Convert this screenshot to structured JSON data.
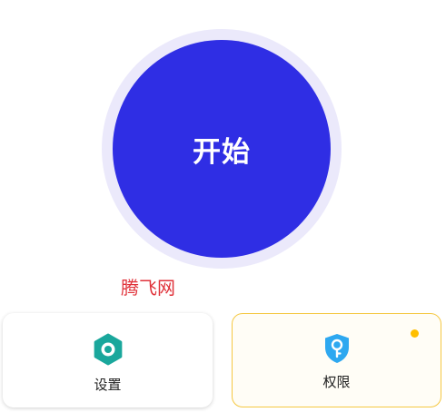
{
  "start": {
    "label": "开始"
  },
  "watermark": {
    "text": "腾飞网"
  },
  "cards": {
    "settings": {
      "label": "设置",
      "icon": "gear-icon"
    },
    "permissions": {
      "label": "权限",
      "icon": "shield-key-icon"
    }
  },
  "colors": {
    "accent": "#2f2ee4",
    "ring": "#ebe9fb",
    "settings_icon": "#1aa79c",
    "permissions_icon": "#2ea8f0",
    "badge": "#ffbf00",
    "watermark": "#e0323a"
  }
}
